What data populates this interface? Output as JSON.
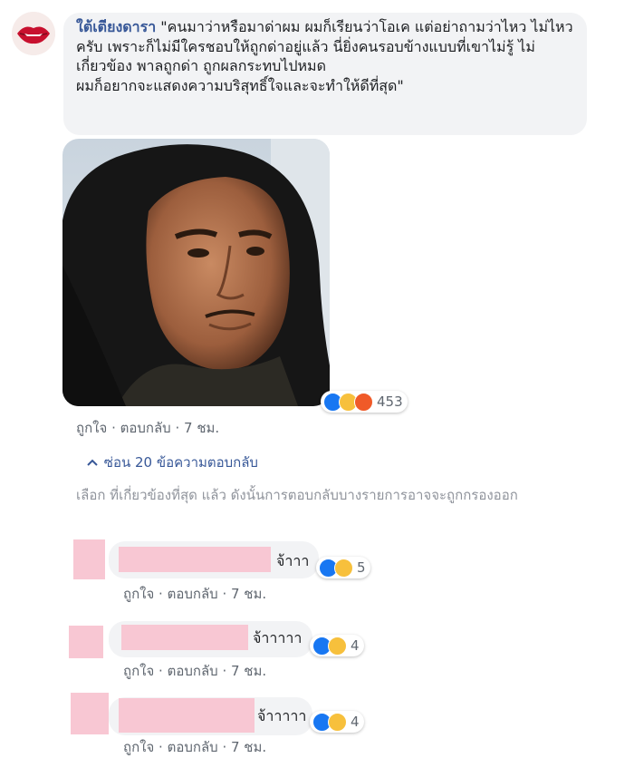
{
  "main_comment": {
    "author": "ใต้เตียงดารา",
    "text": "\"คนมาว่าหรือมาด่าผม ผมก็เรียนว่าโอเค แต่อย่าถามว่าไหว ไม่ไหวครับ เพราะก็ไม่มีใครชอบให้ถูกด่าอยู่แล้ว นี่ยิ่งคนรอบข้างแบบที่เขาไม่รู้ ไม่เกี่ยวข้อง พาลถูกด่า ถูกผลกระทบไปหมด\nผมก็อยากจะแสดงความบริสุทธิ์ใจและจะทำให้ดีที่สุด\"",
    "reaction_count": "453",
    "reactions": [
      "like",
      "haha",
      "angry"
    ],
    "actions": {
      "like": "ถูกใจ",
      "reply": "ตอบกลับ",
      "time": "7 ชม."
    }
  },
  "replies_toggle": "ซ่อน 20 ข้อความตอบกลับ",
  "notice": "เลือก ที่เกี่ยวข้องที่สุด แล้ว ดังนั้นการตอบกลับบางรายการอาจจะถูกกรองออก",
  "replies": [
    {
      "text": "จ้าาา",
      "count": "5",
      "reactions": [
        "like",
        "haha"
      ],
      "like": "ถูกใจ",
      "reply": "ตอบกลับ",
      "time": "7 ชม."
    },
    {
      "text": "จ้าาาาา",
      "count": "4",
      "reactions": [
        "like",
        "haha"
      ],
      "like": "ถูกใจ",
      "reply": "ตอบกลับ",
      "time": "7 ชม."
    },
    {
      "text": "จ้าาาาา",
      "count": "4",
      "reactions": [
        "like",
        "haha"
      ],
      "like": "ถูกใจ",
      "reply": "ตอบกลับ",
      "time": "7 ชม."
    }
  ],
  "colors": {
    "link": "#385898",
    "muted": "#606770",
    "bubble": "#f2f3f5",
    "redact": "#f8c7d3",
    "like": "#1877f2",
    "haha": "#f7c03c",
    "angry": "#f05a28"
  }
}
